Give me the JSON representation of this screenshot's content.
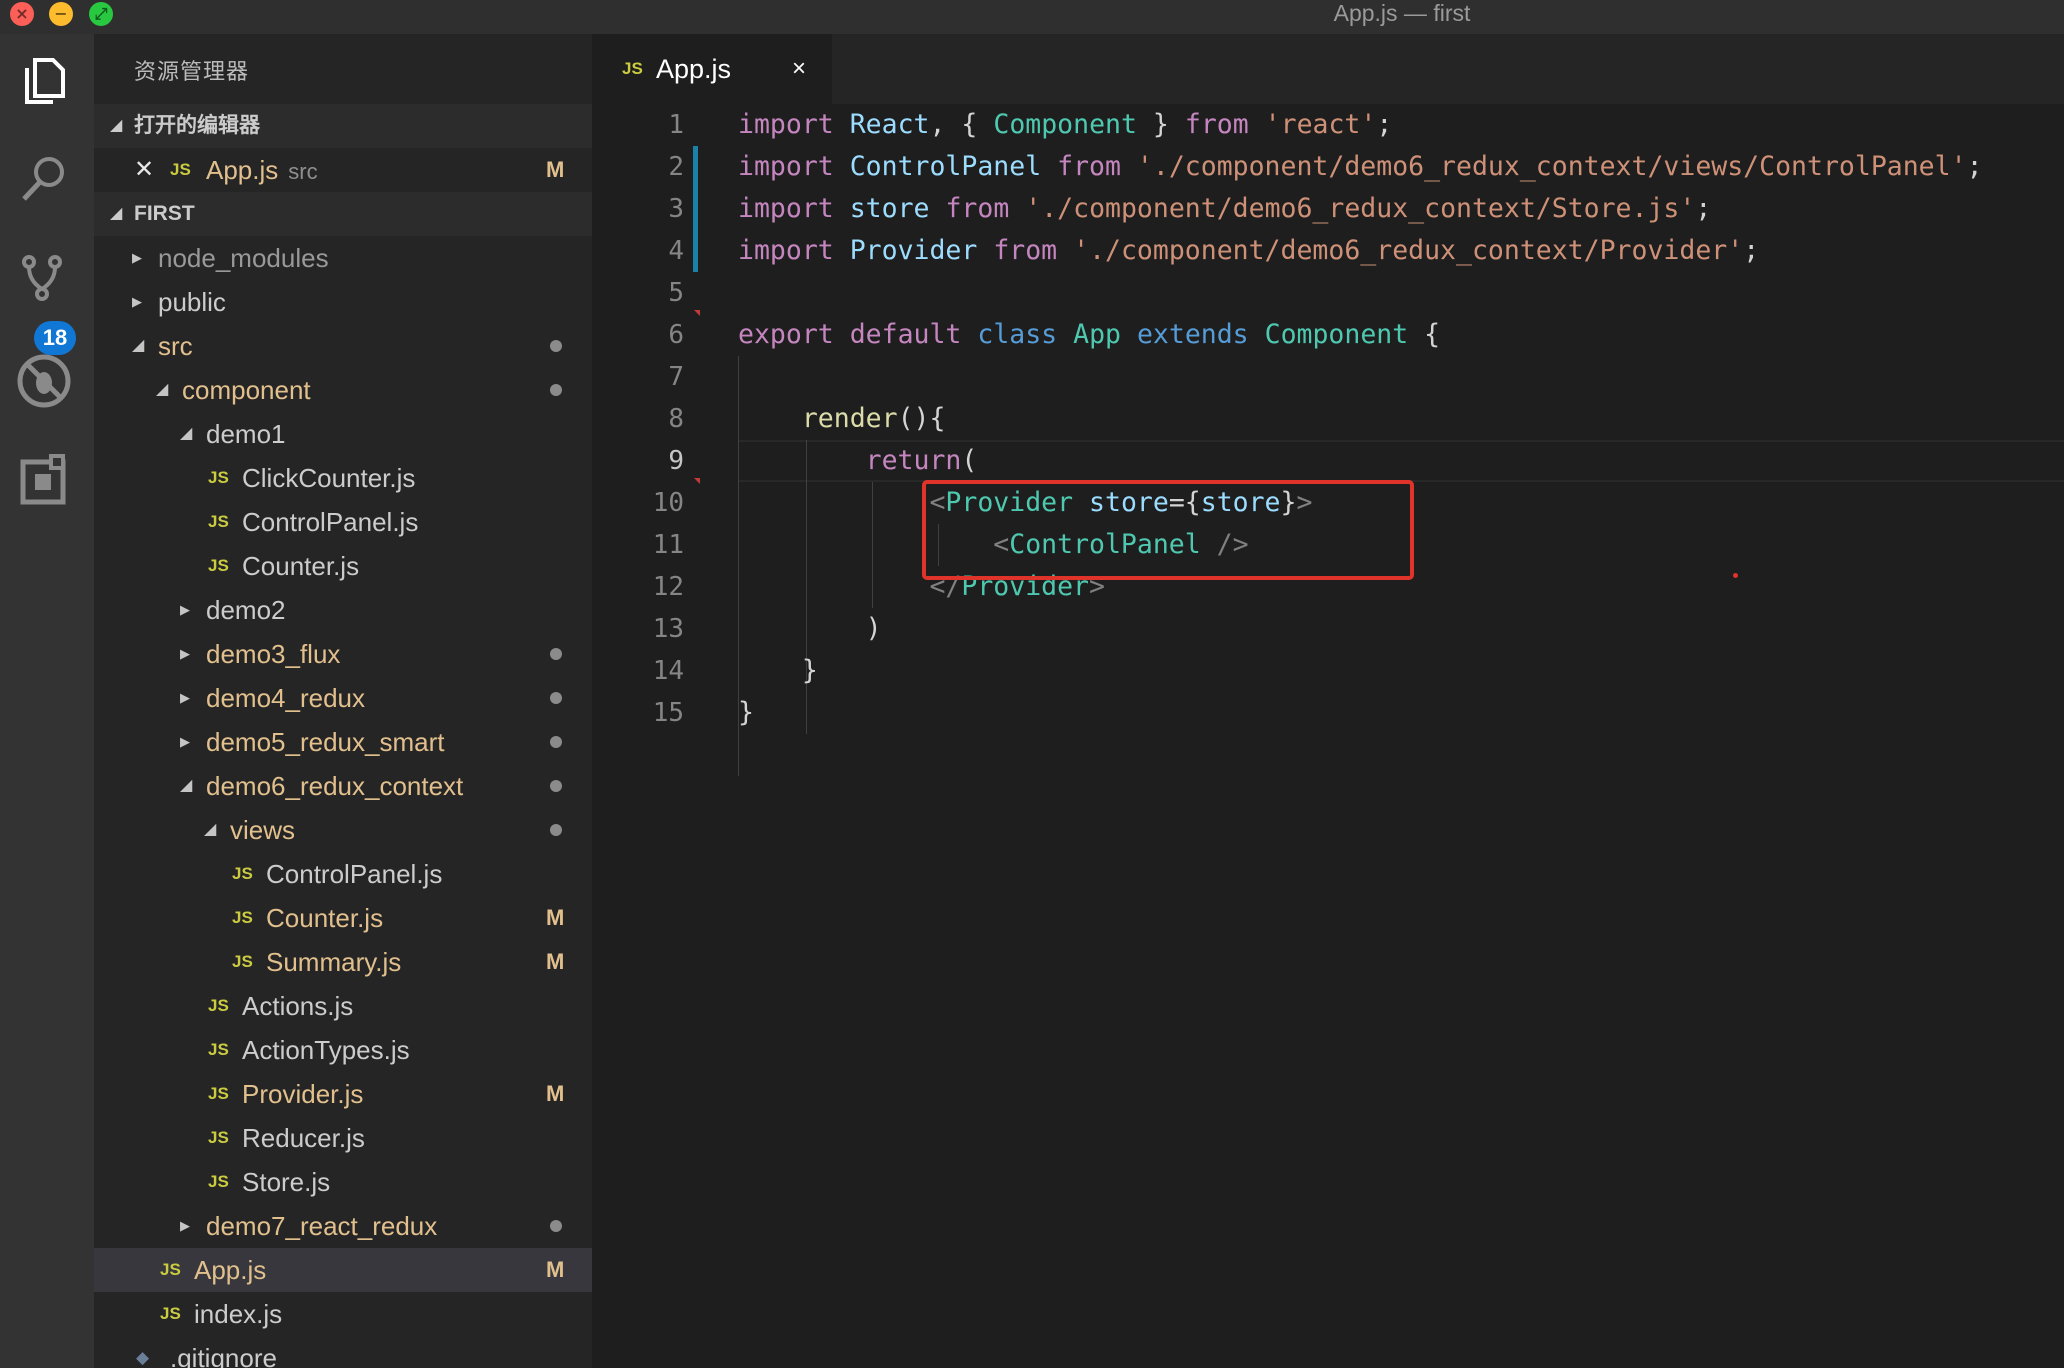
{
  "window": {
    "title": "App.js — first"
  },
  "activity_bar": {
    "items": [
      {
        "icon": "files-icon"
      },
      {
        "icon": "search-icon"
      },
      {
        "icon": "source-control-icon",
        "badge": "18"
      },
      {
        "icon": "debug-icon"
      },
      {
        "icon": "extensions-icon"
      }
    ]
  },
  "sidebar": {
    "title": "资源管理器",
    "open_editors": {
      "label": "打开的编辑器",
      "items": [
        {
          "name": "App.js",
          "folder": "src",
          "status": "M"
        }
      ]
    },
    "project": {
      "label": "FIRST",
      "tree": [
        {
          "name": "node_modules",
          "type": "folder",
          "state": "collapsed"
        },
        {
          "name": "public",
          "type": "folder",
          "state": "collapsed"
        },
        {
          "name": "src",
          "type": "folder",
          "state": "expanded",
          "status": "dot"
        },
        {
          "name": "component",
          "type": "folder",
          "state": "expanded",
          "status": "dot"
        },
        {
          "name": "demo1",
          "type": "folder",
          "state": "expanded"
        },
        {
          "name": "ClickCounter.js",
          "type": "file"
        },
        {
          "name": "ControlPanel.js",
          "type": "file"
        },
        {
          "name": "Counter.js",
          "type": "file"
        },
        {
          "name": "demo2",
          "type": "folder",
          "state": "collapsed"
        },
        {
          "name": "demo3_flux",
          "type": "folder",
          "state": "collapsed",
          "status": "dot"
        },
        {
          "name": "demo4_redux",
          "type": "folder",
          "state": "collapsed",
          "status": "dot"
        },
        {
          "name": "demo5_redux_smart",
          "type": "folder",
          "state": "collapsed",
          "status": "dot"
        },
        {
          "name": "demo6_redux_context",
          "type": "folder",
          "state": "expanded",
          "status": "dot"
        },
        {
          "name": "views",
          "type": "folder",
          "state": "expanded",
          "status": "dot"
        },
        {
          "name": "ControlPanel.js",
          "type": "file"
        },
        {
          "name": "Counter.js",
          "type": "file",
          "status": "M"
        },
        {
          "name": "Summary.js",
          "type": "file",
          "status": "M"
        },
        {
          "name": "Actions.js",
          "type": "file"
        },
        {
          "name": "ActionTypes.js",
          "type": "file"
        },
        {
          "name": "Provider.js",
          "type": "file",
          "status": "M"
        },
        {
          "name": "Reducer.js",
          "type": "file"
        },
        {
          "name": "Store.js",
          "type": "file"
        },
        {
          "name": "demo7_react_redux",
          "type": "folder",
          "state": "collapsed",
          "status": "dot"
        },
        {
          "name": "App.js",
          "type": "file",
          "status": "M"
        },
        {
          "name": "index.js",
          "type": "file"
        },
        {
          "name": ".gitignore",
          "type": "file"
        }
      ]
    }
  },
  "editor": {
    "tab": {
      "icon": "JS",
      "label": "App.js",
      "close": "×"
    },
    "cursor_line": 9,
    "lines": [
      {
        "n": "1",
        "text": "import React, { Component } from 'react';"
      },
      {
        "n": "2",
        "text": "import ControlPanel from './component/demo6_redux_context/views/ControlPanel';"
      },
      {
        "n": "3",
        "text": "import store from './component/demo6_redux_context/Store.js';"
      },
      {
        "n": "4",
        "text": "import Provider from './component/demo6_redux_context/Provider';"
      },
      {
        "n": "5",
        "text": ""
      },
      {
        "n": "6",
        "text": "export default class App extends Component {"
      },
      {
        "n": "7",
        "text": ""
      },
      {
        "n": "8",
        "text": "    render(){"
      },
      {
        "n": "9",
        "text": "        return("
      },
      {
        "n": "10",
        "text": "            <Provider store={store}>"
      },
      {
        "n": "11",
        "text": "                <ControlPanel />"
      },
      {
        "n": "12",
        "text": "            </Provider>"
      },
      {
        "n": "13",
        "text": "        )"
      },
      {
        "n": "14",
        "text": "    }"
      },
      {
        "n": "15",
        "text": "}"
      }
    ]
  },
  "colors": {
    "keyword": "#c586c0",
    "variable": "#9cdcfe",
    "string": "#ce9178",
    "type": "#4ec9b0",
    "function": "#dcdcaa",
    "highlight_box": "#e0332a",
    "modified": "#e2c08d"
  }
}
